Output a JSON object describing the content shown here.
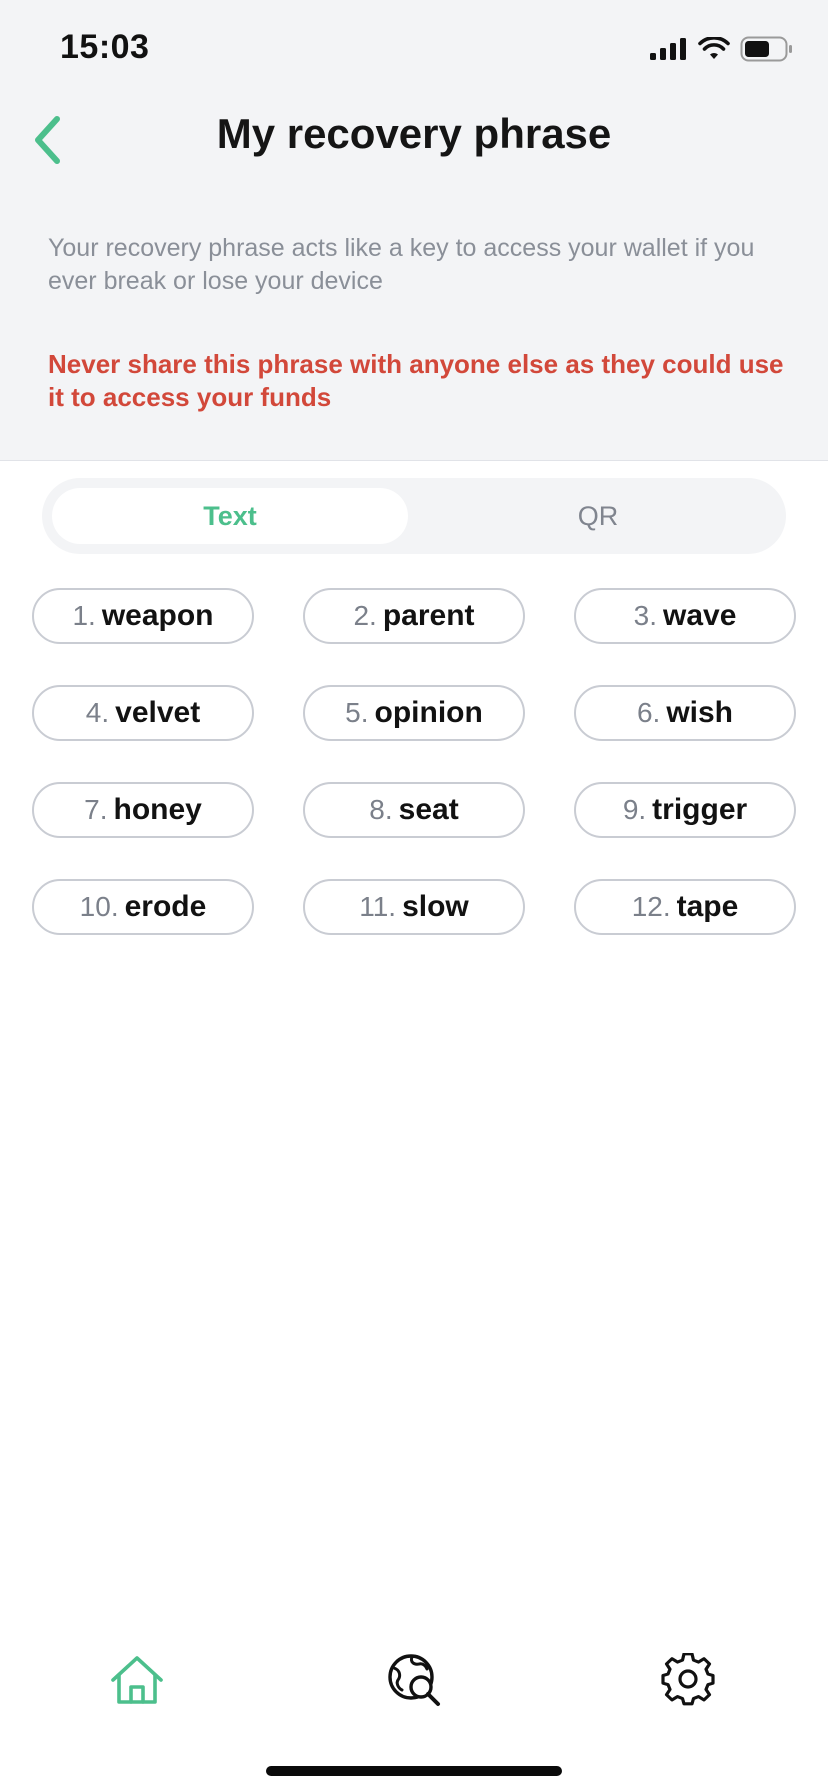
{
  "status_bar": {
    "time": "15:03"
  },
  "header": {
    "title": "My recovery phrase",
    "back_icon": "chevron-left-icon"
  },
  "description": "Your recovery phrase acts like a key to access your wallet if you ever break or lose your device",
  "warning": "Never share this phrase with anyone else as they could use it to access your funds",
  "segmented_control": {
    "options": [
      {
        "label": "Text",
        "selected": true
      },
      {
        "label": "QR",
        "selected": false
      }
    ]
  },
  "words": [
    {
      "number": "1.",
      "word": "weapon"
    },
    {
      "number": "2.",
      "word": "parent"
    },
    {
      "number": "3.",
      "word": "wave"
    },
    {
      "number": "4.",
      "word": "velvet"
    },
    {
      "number": "5.",
      "word": "opinion"
    },
    {
      "number": "6.",
      "word": "wish"
    },
    {
      "number": "7.",
      "word": "honey"
    },
    {
      "number": "8.",
      "word": "seat"
    },
    {
      "number": "9.",
      "word": "trigger"
    },
    {
      "number": "10.",
      "word": "erode"
    },
    {
      "number": "11.",
      "word": "slow"
    },
    {
      "number": "12.",
      "word": "tape"
    }
  ],
  "tab_bar": {
    "items": [
      {
        "icon": "home-icon",
        "active": true
      },
      {
        "icon": "globe-search-icon",
        "active": false
      },
      {
        "icon": "gear-icon",
        "active": false
      }
    ]
  },
  "colors": {
    "accent": "#4cbf8c",
    "warning": "#d2483a",
    "muted_text": "#8a8f98",
    "header_bg": "#f3f4f6"
  }
}
